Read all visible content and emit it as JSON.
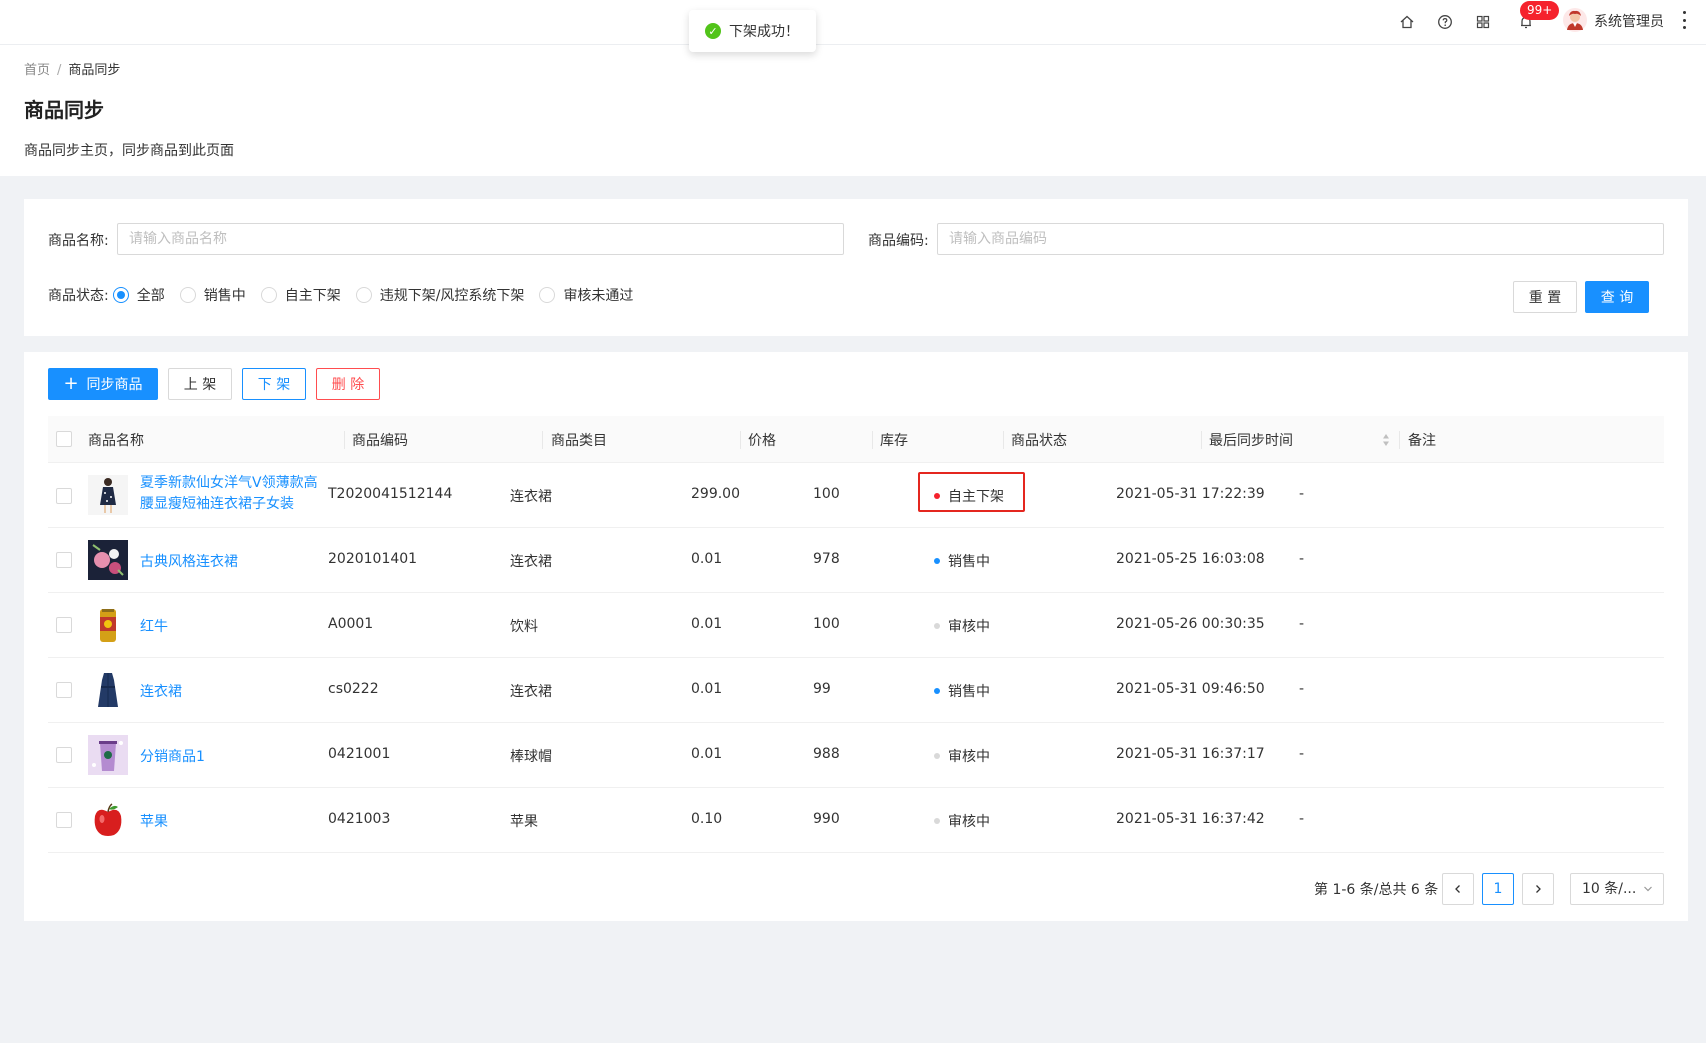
{
  "header": {
    "notification_badge": "99+",
    "username": "系统管理员",
    "icons": [
      "home-icon",
      "help-icon",
      "apps-icon",
      "bell-icon",
      "more-icon"
    ]
  },
  "toast": {
    "message": "下架成功！",
    "type": "success"
  },
  "breadcrumb": {
    "home": "首页",
    "current": "商品同步"
  },
  "page": {
    "title": "商品同步",
    "description": "商品同步主页，同步商品到此页面"
  },
  "filters": {
    "name_label": "商品名称:",
    "name_placeholder": "请输入商品名称",
    "code_label": "商品编码:",
    "code_placeholder": "请输入商品编码",
    "status_label": "商品状态:",
    "status_options": [
      "全部",
      "销售中",
      "自主下架",
      "违规下架/风控系统下架",
      "审核未通过"
    ],
    "selected_status": "全部",
    "reset_label": "重 置",
    "search_label": "查 询"
  },
  "toolbar": {
    "sync_label": "同步商品",
    "onshelf_label": "上 架",
    "offshelf_label": "下 架",
    "delete_label": "删 除"
  },
  "table": {
    "columns": [
      "商品名称",
      "商品编码",
      "商品类目",
      "价格",
      "库存",
      "商品状态",
      "最后同步时间",
      "备注"
    ],
    "rows": [
      {
        "name_line1": "夏季新款仙女洋气V领薄款高",
        "name_line2": "腰显瘦短袖连衣裙子女装",
        "code": "T2020041512144",
        "category": "连衣裙",
        "price": "299.00",
        "stock": "100",
        "status": "自主下架",
        "status_color": "#f5222d",
        "time": "2021-05-31 17:22:39",
        "remark": "-",
        "thumb": "dress-photo"
      },
      {
        "name_line1": "古典风格连衣裙",
        "name_line2": "",
        "code": "2020101401",
        "category": "连衣裙",
        "price": "0.01",
        "stock": "978",
        "status": "销售中",
        "status_color": "#1890ff",
        "time": "2021-05-25 16:03:08",
        "remark": "-",
        "thumb": "floral-dress-photo"
      },
      {
        "name_line1": "红牛",
        "name_line2": "",
        "code": "A0001",
        "category": "饮料",
        "price": "0.01",
        "stock": "100",
        "status": "审核中",
        "status_color": "#d9d9d9",
        "time": "2021-05-26 00:30:35",
        "remark": "-",
        "thumb": "energy-drink-photo"
      },
      {
        "name_line1": "连衣裙",
        "name_line2": "",
        "code": "cs0222",
        "category": "连衣裙",
        "price": "0.01",
        "stock": "99",
        "status": "销售中",
        "status_color": "#1890ff",
        "time": "2021-05-31 09:46:50",
        "remark": "-",
        "thumb": "navy-dress-photo"
      },
      {
        "name_line1": "分销商品1",
        "name_line2": "",
        "code": "0421001",
        "category": "棒球帽",
        "price": "0.01",
        "stock": "988",
        "status": "审核中",
        "status_color": "#d9d9d9",
        "time": "2021-05-31 16:37:17",
        "remark": "-",
        "thumb": "coffee-cup-photo"
      },
      {
        "name_line1": "苹果",
        "name_line2": "",
        "code": "0421003",
        "category": "苹果",
        "price": "0.10",
        "stock": "990",
        "status": "审核中",
        "status_color": "#d9d9d9",
        "time": "2021-05-31 16:37:42",
        "remark": "-",
        "thumb": "apple-photo"
      }
    ]
  },
  "pagination": {
    "summary": "第 1-6 条/总共 6 条",
    "current_page": "1",
    "page_size": "10 条/..."
  }
}
